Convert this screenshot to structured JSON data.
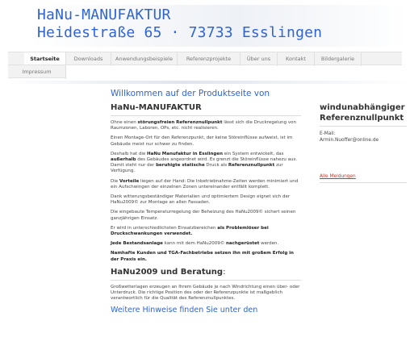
{
  "header": {
    "line1": "HaNu-MANUFAKTUR",
    "line2": "Heidestraße 65 · 73733 Esslingen"
  },
  "nav": {
    "items": [
      {
        "label": "Startseite",
        "active": true
      },
      {
        "label": "Downloads"
      },
      {
        "label": "Anwendungsbeispiele"
      },
      {
        "label": "Referenzprojekte"
      },
      {
        "label": "Über uns"
      },
      {
        "label": "Kontakt"
      },
      {
        "label": "Bildergalerie"
      },
      {
        "label": "Impressum"
      }
    ]
  },
  "main": {
    "welcome": "Willkommen auf der Produktseite von",
    "company": "HaNu-MANUFAKTUR",
    "p1a": "Ohne einen ",
    "p1b": "störungsfreien Referenznullpunkt",
    "p1c": " lässt sich die Druckregelung von Raumzonen, Laboren, OPs, etc. nicht realisieren.",
    "p2": "Einen Montage-Ort für den Referenzpunkt, der keine Störeinflüsse aufweist, ist im Gebäude meist nur schwer zu finden.",
    "p3a": "Deshalb hat die ",
    "p3b": "HaNu Manufaktur in Esslingen",
    "p3c": " ein System entwickelt, das ",
    "p3d": "außerhalb",
    "p3e": " des Gebäudes angeordnet wird. Es grenzt die Störeinflüsse nahezu aus. Damit steht nur der ",
    "p3f": "beruhigte statische",
    "p3g": " Druck als ",
    "p3h": "Referenznullpunkt",
    "p3i": " zur Verfügung.",
    "p4a": "Die ",
    "p4b": "Vorteile",
    "p4c": " liegen auf der Hand: Die Inbetriebnahme-Zeiten werden minimiert und ein Aufschwingen der einzelnen Zonen untereinander entfällt komplett.",
    "p5": "Dank witterungsbeständiger Materialien und optimiertem Design eignet sich der HaNu2009© zur Montage an allen Fassaden.",
    "p6": "Die eingebaute Temperaturregelung der Beheizung des HaNu2009© sichert seinen ganzjährigen Einsatz.",
    "p7a": "Er wird in unterschiedlichsten Einsatzbereichen ",
    "p7b": "als Problemlöser bei Druckschwankungen verwendet.",
    "p8a": "Jede Bestandsanlage",
    "p8b": " kann mit dem HaNu2009© ",
    "p8c": "nachgerüstet",
    "p8d": " werden.",
    "p9": "Namhafte Kunden und TGA-Fachbetriebe setzen ihn mit großem Erfolg in der Praxis ein.",
    "section2_title": "HaNu2009 und Beratung",
    "section2_colon": ":",
    "p10": "Großwetterlagen erzeugen an Ihrem Gebäude je nach Windrichtung einen über- oder Unterdruck. Die richtige Position des oder der Referenzpunkte ist maßgeblich verantwortlich für die Qualität des Referenznullpunktes.",
    "more": "Weitere Hinweise finden Sie unter den"
  },
  "sidebar": {
    "title": "windunabhängiger Referenznullpunkt",
    "email_label": "E-Mail:",
    "email": "Armin.Nuoffer@online.de",
    "link": "Alle Meldungen"
  }
}
